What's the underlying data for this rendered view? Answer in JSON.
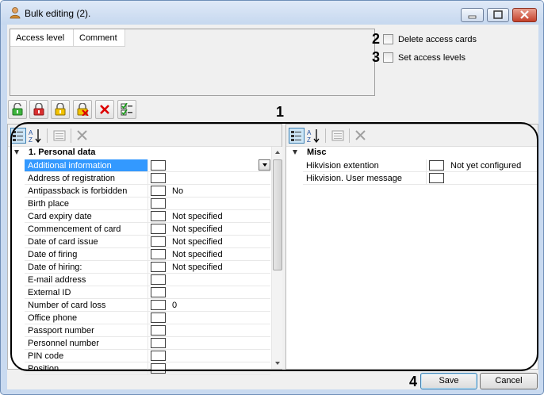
{
  "window": {
    "title": "Bulk editing (2).",
    "min_icon": "minimize-icon",
    "max_icon": "maximize-icon",
    "close_icon": "close-icon"
  },
  "access_list": {
    "columns": [
      "Access level",
      "Comment"
    ]
  },
  "options": {
    "delete_cards_label": "Delete access cards",
    "set_levels_label": "Set access levels",
    "delete_cards_checked": false,
    "set_levels_checked": false
  },
  "callouts": {
    "one": "1",
    "two": "2",
    "three": "3",
    "four": "4"
  },
  "toolbar": {
    "buttons": [
      "unlock-green-icon",
      "lock-red-icon",
      "lock-yellow-icon",
      "delete-lock-icon",
      "delete-x-icon",
      "checklist-icon"
    ]
  },
  "property_panel_tools": [
    "categorized-icon",
    "alphabetical-sort-icon",
    "property-pages-icon",
    "clear-icon"
  ],
  "left_panel": {
    "category": "1. Personal data",
    "rows": [
      {
        "name": "Additional information",
        "value": "",
        "selected": true,
        "dropdown": true
      },
      {
        "name": "Address of registration",
        "value": ""
      },
      {
        "name": "Antipassback is forbidden",
        "value": "No"
      },
      {
        "name": "Birth place",
        "value": ""
      },
      {
        "name": "Card expiry date",
        "value": "Not specified"
      },
      {
        "name": "Commencement of card",
        "value": "Not specified"
      },
      {
        "name": "Date of card issue",
        "value": "Not specified"
      },
      {
        "name": "Date of firing",
        "value": "Not specified"
      },
      {
        "name": "Date of hiring:",
        "value": "Not specified"
      },
      {
        "name": "E-mail address",
        "value": ""
      },
      {
        "name": "External ID",
        "value": ""
      },
      {
        "name": "Number of card loss",
        "value": "0"
      },
      {
        "name": "Office phone",
        "value": ""
      },
      {
        "name": "Passport number",
        "value": ""
      },
      {
        "name": "Personnel number",
        "value": ""
      },
      {
        "name": "PIN code",
        "value": ""
      },
      {
        "name": "Position",
        "value": ""
      }
    ]
  },
  "right_panel": {
    "category": "Misc",
    "rows": [
      {
        "name": "Hikvision extention",
        "value": "Not yet configured"
      },
      {
        "name": "Hikvision. User message",
        "value": ""
      }
    ]
  },
  "buttons": {
    "save": "Save",
    "cancel": "Cancel"
  },
  "colors": {
    "selection": "#3399ff",
    "frame": "#c9daf0"
  }
}
